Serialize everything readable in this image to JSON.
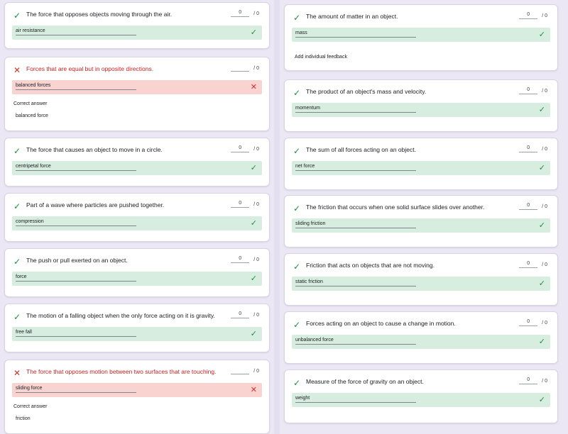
{
  "colors": {
    "correct": "#1e8e3e",
    "incorrect": "#d93025",
    "correct_bg": "#d7eddf",
    "incorrect_bg": "#f9d3d0"
  },
  "icons": {
    "correct": "✓",
    "incorrect": "✕"
  },
  "labels": {
    "correct_answer": "Correct answer",
    "add_feedback": "Add individual feedback"
  },
  "left": [
    {
      "question": "The force that opposes objects moving through the air.",
      "score": "0",
      "max": "/ 0",
      "answer": "air resistance",
      "status": "correct"
    },
    {
      "question": "Forces that are equal but in opposite directions.",
      "score": "",
      "max": "/ 0",
      "answer": "balanced forces",
      "status": "incorrect",
      "correct_answer": "balanced force"
    },
    {
      "question": "The force that causes an object to move in a circle.",
      "score": "0",
      "max": "/ 0",
      "answer": "centripetal force",
      "status": "correct"
    },
    {
      "question": "Part of a wave where particles are pushed together.",
      "score": "0",
      "max": "/ 0",
      "answer": "compression",
      "status": "correct"
    },
    {
      "question": " The push or pull exerted on an object.",
      "score": "0",
      "max": "/ 0",
      "answer": "force",
      "status": "correct"
    },
    {
      "question": "The motion of a falling object when the only force acting on it is gravity.",
      "score": "0",
      "max": "/ 0",
      "answer": "free fall",
      "status": "correct"
    },
    {
      "question": "The force that opposes motion between two surfaces that are touching.",
      "score": "",
      "max": "/ 0",
      "answer": "sliding force",
      "status": "incorrect",
      "correct_answer": "friction"
    }
  ],
  "right": [
    {
      "question": "The amount of matter in an object.",
      "score": "0",
      "max": "/ 0",
      "answer": "mass",
      "status": "correct",
      "feedback": true
    },
    {
      "question": "The product of an object's mass and velocity.",
      "score": "0",
      "max": "/ 0",
      "answer": "momentum",
      "status": "correct"
    },
    {
      "question": "The sum of all forces acting on an object.",
      "score": "0",
      "max": "/ 0",
      "answer": "net force",
      "status": "correct"
    },
    {
      "question": "The friction that occurs when one solid surface slides over another.",
      "score": "0",
      "max": "/ 0",
      "answer": "sliding friction",
      "status": "correct"
    },
    {
      "question": "Friction that acts on objects that are not moving.",
      "score": "0",
      "max": "/ 0",
      "answer": "static friction",
      "status": "correct"
    },
    {
      "question": "Forces acting on an object to cause a change in motion.",
      "score": "0",
      "max": "/ 0",
      "answer": "unbalanced force",
      "status": "correct"
    },
    {
      "question": "Measure of the force of gravity on an object.",
      "score": "0",
      "max": "/ 0",
      "answer": "weight",
      "status": "correct"
    }
  ]
}
